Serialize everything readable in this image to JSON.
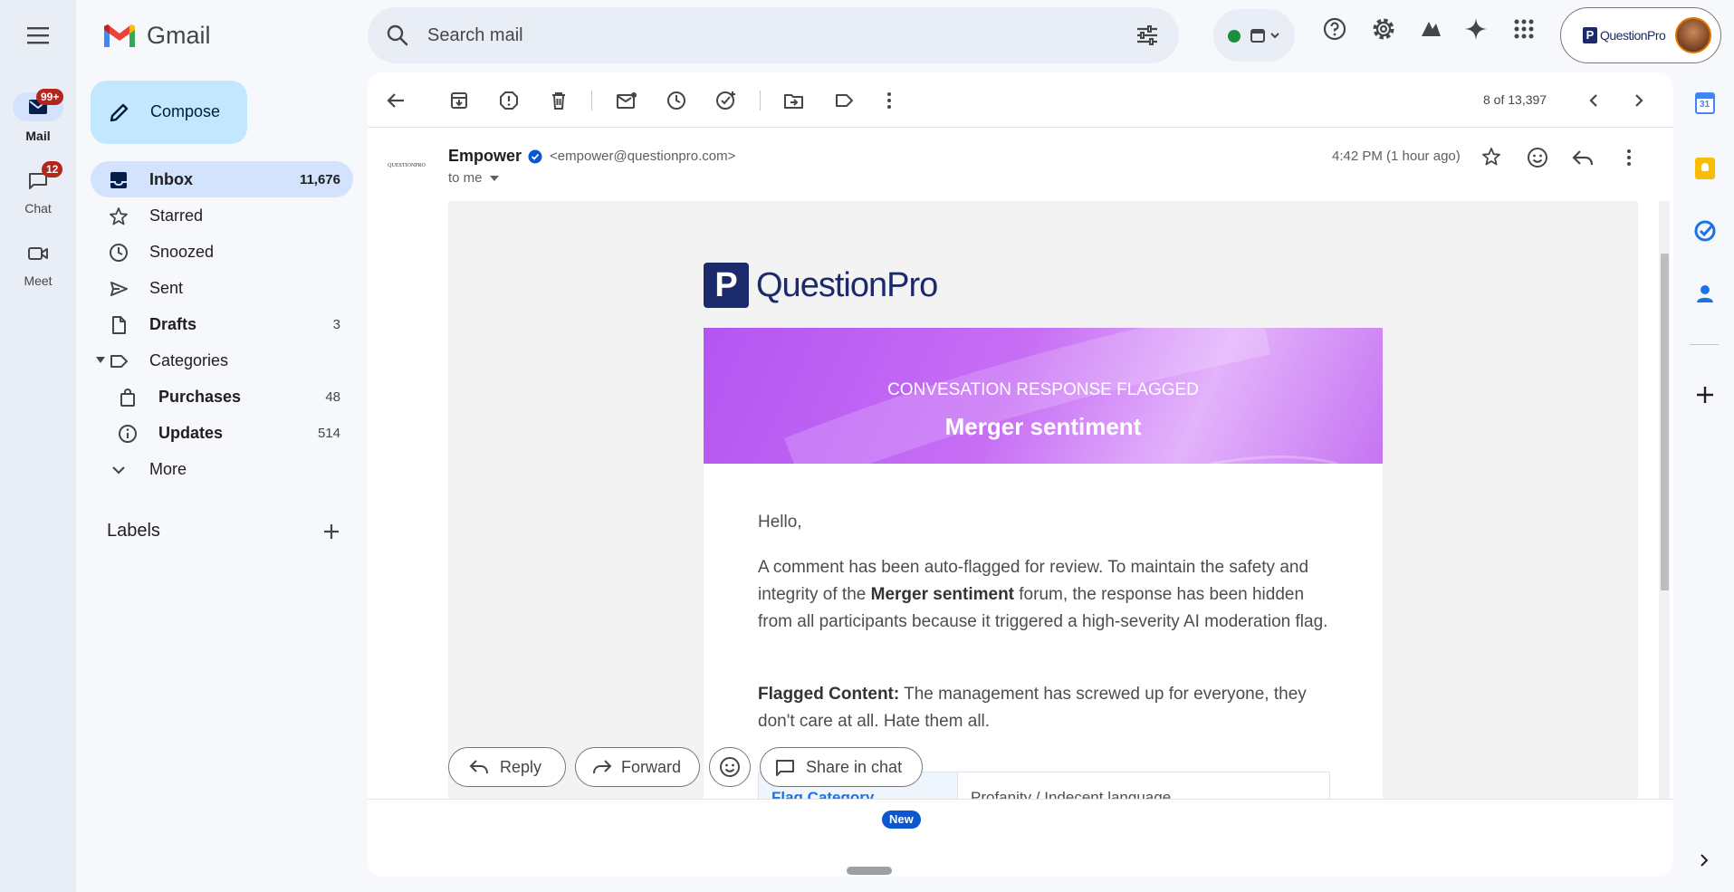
{
  "app": {
    "name": "Gmail"
  },
  "rail": {
    "mail_label": "Mail",
    "mail_badge": "99+",
    "chat_label": "Chat",
    "chat_badge": "12",
    "meet_label": "Meet"
  },
  "search": {
    "placeholder": "Search mail"
  },
  "account": {
    "org_label": "QuestionPro"
  },
  "compose_label": "Compose",
  "sidebar": {
    "items": [
      {
        "label": "Inbox",
        "count": "11,676",
        "icon": "inbox-icon"
      },
      {
        "label": "Starred",
        "count": "",
        "icon": "star-icon"
      },
      {
        "label": "Snoozed",
        "count": "",
        "icon": "clock-icon"
      },
      {
        "label": "Sent",
        "count": "",
        "icon": "send-icon"
      },
      {
        "label": "Drafts",
        "count": "3",
        "icon": "draft-icon"
      },
      {
        "label": "Categories",
        "count": "",
        "icon": "label-icon"
      },
      {
        "label": "Purchases",
        "count": "48",
        "icon": "bag-icon"
      },
      {
        "label": "Updates",
        "count": "514",
        "icon": "info-icon"
      },
      {
        "label": "More",
        "count": "",
        "icon": "chevron-down-icon"
      }
    ],
    "labels_heading": "Labels"
  },
  "toolbar": {
    "pagination": "8 of 13,397"
  },
  "email": {
    "sender_name": "Empower",
    "sender_email": "<empower@questionpro.com>",
    "recipient": "to me",
    "time": "4:42 PM (1 hour ago)",
    "avatar_text": "QUESTIONPRO",
    "logo_text": "QuestionPro",
    "banner_subtitle": "CONVESATION RESPONSE FLAGGED",
    "banner_title": "Merger sentiment",
    "greeting": "Hello,",
    "para1_a": "A comment has been auto-flagged for review. To maintain the safety and integrity of the ",
    "para1_bold": "Merger sentiment",
    "para1_b": " forum, the response has been hidden from all participants because it triggered a high-severity AI moderation flag.",
    "flagged_label": "Flagged Content:",
    "flagged_text": " The management has screwed up for everyone, they don't care at all. Hate them all.",
    "table": {
      "key": "Flag Category",
      "value": "Profanity / Indecent language"
    }
  },
  "actions": {
    "reply": "Reply",
    "forward": "Forward",
    "share": "Share in chat",
    "new_badge": "New"
  },
  "colors": {
    "accent": "#0b57d0",
    "selected_nav": "#d3e3fd",
    "compose_bg": "#c2e7ff",
    "banner_purple": "#b455f2",
    "badge_red": "#b3261e",
    "logo_navy": "#1b2a6b"
  }
}
